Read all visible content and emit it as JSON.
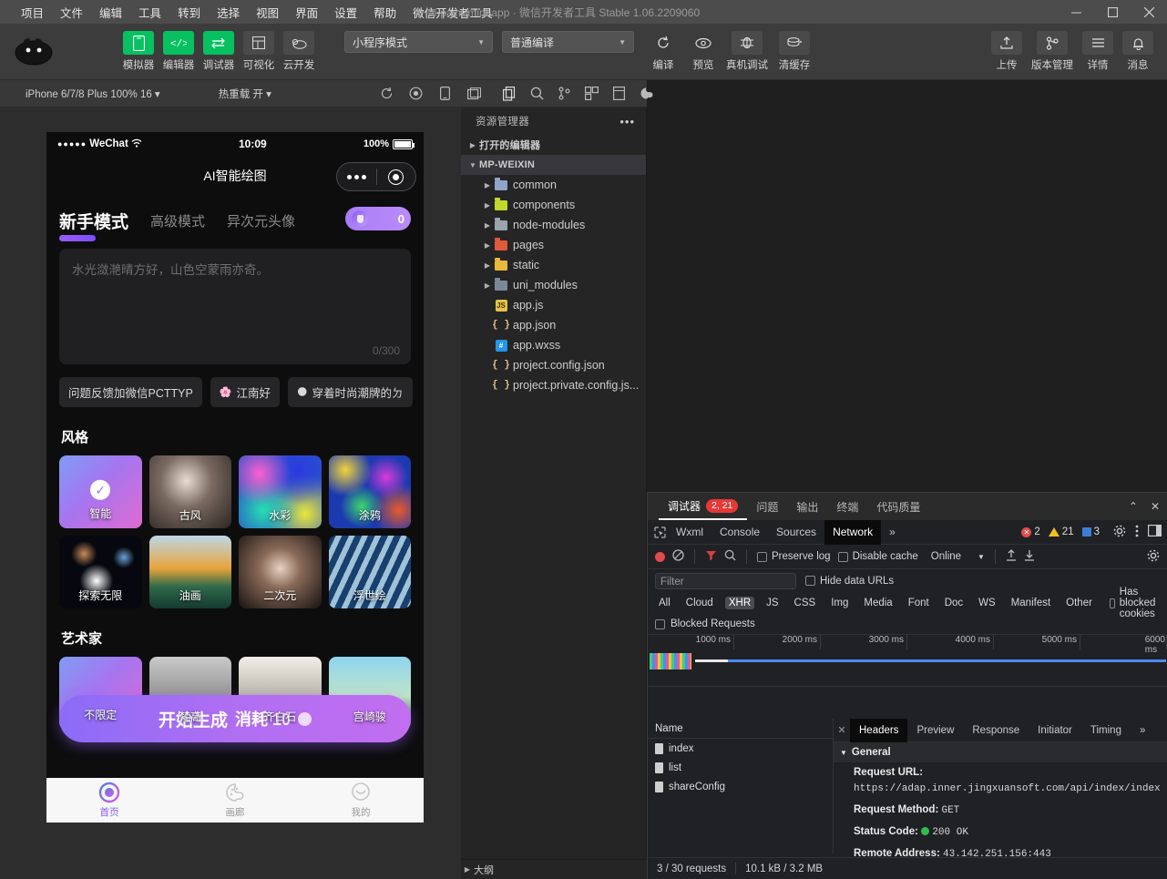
{
  "titlebar": {
    "menus": [
      "项目",
      "文件",
      "编辑",
      "工具",
      "转到",
      "选择",
      "视图",
      "界面",
      "设置",
      "帮助",
      "微信开发者工具"
    ],
    "title": "ai-paint-mini-app · 微信开发者工具 Stable 1.06.2209060",
    "minimize": "—",
    "maximize": "▢",
    "close": "✕"
  },
  "toolbar": {
    "left_buttons": [
      {
        "label": "模拟器",
        "icon": "phone-icon",
        "green": true
      },
      {
        "label": "编辑器",
        "icon": "code-icon",
        "green": true
      },
      {
        "label": "调试器",
        "icon": "debug-icon",
        "green": true
      },
      {
        "label": "可视化",
        "icon": "layout-icon",
        "green": false
      },
      {
        "label": "云开发",
        "icon": "cloud-icon",
        "green": false
      }
    ],
    "mode_select": "小程序模式",
    "compile_select": "普通编译",
    "mid_buttons": [
      {
        "label": "编译",
        "icon": "refresh-icon"
      },
      {
        "label": "预览",
        "icon": "eye-icon"
      },
      {
        "label": "真机调试",
        "icon": "device-debug-icon"
      },
      {
        "label": "清缓存",
        "icon": "clear-cache-icon"
      }
    ],
    "right_buttons": [
      {
        "label": "上传",
        "icon": "upload-icon"
      },
      {
        "label": "版本管理",
        "icon": "branch-icon"
      },
      {
        "label": "详情",
        "icon": "details-icon"
      },
      {
        "label": "消息",
        "icon": "bell-icon"
      }
    ]
  },
  "simbar": {
    "device": "iPhone 6/7/8 Plus 100% 16 ▾",
    "hot_reload": "热重载 开 ▾",
    "icons": [
      "rotate-icon",
      "record-icon",
      "mobile-icon",
      "screenshot-icon",
      "copy-icon",
      "search-icon",
      "git-icon",
      "component-icon",
      "panel-icon",
      "paint-icon"
    ]
  },
  "phone": {
    "status": {
      "carrier": "WeChat",
      "time": "10:09",
      "battery": "100%"
    },
    "nav_title": "AI智能绘图",
    "tabs": [
      {
        "label": "新手模式",
        "active": true
      },
      {
        "label": "高级模式",
        "active": false
      },
      {
        "label": "异次元头像",
        "active": false
      }
    ],
    "coins": "0",
    "prompt": {
      "placeholder": "水光潋滟晴方好，山色空蒙雨亦奇。",
      "counter": "0/300"
    },
    "chips": [
      {
        "label": "问题反馈加微信PCTTYP",
        "emoji": ""
      },
      {
        "label": "江南好",
        "emoji": "🌸"
      },
      {
        "label": "穿着时尚潮牌的ㄉ",
        "emoji": "🌑"
      }
    ],
    "style_section": "风格",
    "styles": [
      {
        "label": "智能",
        "selected": true
      },
      {
        "label": "古风",
        "selected": false
      },
      {
        "label": "水彩",
        "selected": false
      },
      {
        "label": "涂鸦",
        "selected": false
      },
      {
        "label": "探索无限",
        "selected": false
      },
      {
        "label": "油画",
        "selected": false
      },
      {
        "label": "二次元",
        "selected": false
      },
      {
        "label": "浮世绘",
        "selected": false
      }
    ],
    "artist_section": "艺术家",
    "artists": [
      {
        "label": "不限定",
        "selected": true
      },
      {
        "label": "梵高",
        "selected": false
      },
      {
        "label": "齐白石",
        "selected": false
      },
      {
        "label": "宫崎骏",
        "selected": false
      }
    ],
    "cta": {
      "label": "开始生成",
      "cost": "消耗 10"
    },
    "tabbar": [
      {
        "label": "首页",
        "active": true,
        "icon": "home-icon"
      },
      {
        "label": "画廊",
        "active": false,
        "icon": "gallery-icon"
      },
      {
        "label": "我的",
        "active": false,
        "icon": "profile-icon"
      }
    ]
  },
  "explorer": {
    "title": "资源管理器",
    "more": "•••",
    "open_editors": "打开的编辑器",
    "project": "MP-WEIXIN",
    "outline": "大纲",
    "files": [
      {
        "name": "common",
        "type": "folder",
        "color": "#8fa5c8",
        "depth": 2
      },
      {
        "name": "components",
        "type": "folder",
        "color": "#c2d82e",
        "depth": 2
      },
      {
        "name": "node-modules",
        "type": "folder",
        "color": "#9aa4ad",
        "depth": 2
      },
      {
        "name": "pages",
        "type": "folder",
        "color": "#e05a3a",
        "depth": 2
      },
      {
        "name": "static",
        "type": "folder",
        "color": "#e8b93a",
        "depth": 2
      },
      {
        "name": "uni_modules",
        "type": "folder",
        "color": "#7b8996",
        "depth": 2
      },
      {
        "name": "app.js",
        "type": "js",
        "depth": 2
      },
      {
        "name": "app.json",
        "type": "json",
        "depth": 2
      },
      {
        "name": "app.wxss",
        "type": "wxss",
        "depth": 2
      },
      {
        "name": "project.config.json",
        "type": "json",
        "depth": 2
      },
      {
        "name": "project.private.config.js...",
        "type": "json",
        "depth": 2
      }
    ]
  },
  "devtools": {
    "panel_tabs": [
      {
        "label": "调试器",
        "active": true,
        "badge": "2, 21"
      },
      {
        "label": "问题",
        "active": false
      },
      {
        "label": "输出",
        "active": false
      },
      {
        "label": "终端",
        "active": false
      },
      {
        "label": "代码质量",
        "active": false
      }
    ],
    "collapse": "⌃",
    "close": "✕",
    "subtabs": [
      {
        "label": "Wxml",
        "active": false
      },
      {
        "label": "Console",
        "active": false
      },
      {
        "label": "Sources",
        "active": false
      },
      {
        "label": "Network",
        "active": true
      },
      {
        "label": "»",
        "active": false
      }
    ],
    "counts": {
      "errors": "2",
      "warnings": "21",
      "infos": "3"
    },
    "network_controls": {
      "preserve_log": "Preserve log",
      "disable_cache": "Disable cache",
      "throttle": "Online",
      "filter_placeholder": "Filter",
      "hide_data_urls": "Hide data URLs",
      "blocked_requests": "Blocked Requests",
      "has_blocked_cookies": "Has blocked cookies",
      "types": [
        "All",
        "Cloud",
        "XHR",
        "JS",
        "CSS",
        "Img",
        "Media",
        "Font",
        "Doc",
        "WS",
        "Manifest",
        "Other"
      ],
      "selected_type": "XHR"
    },
    "overview_ticks": [
      "1000 ms",
      "2000 ms",
      "3000 ms",
      "4000 ms",
      "5000 ms",
      "6000 ms"
    ],
    "request_list": {
      "header": "Name",
      "rows": [
        "index",
        "list",
        "shareConfig"
      ]
    },
    "detail_tabs": [
      {
        "label": "Headers",
        "active": true
      },
      {
        "label": "Preview",
        "active": false
      },
      {
        "label": "Response",
        "active": false
      },
      {
        "label": "Initiator",
        "active": false
      },
      {
        "label": "Timing",
        "active": false
      },
      {
        "label": "»",
        "active": false
      }
    ],
    "general_section": "General",
    "headers": [
      {
        "key": "Request URL:",
        "value": "https://adap.inner.jingxuansoft.com/api/index/index"
      },
      {
        "key": "Request Method:",
        "value": "GET"
      },
      {
        "key": "Status Code:",
        "value": "200 OK",
        "status": true
      },
      {
        "key": "Remote Address:",
        "value": "43.142.251.156:443"
      }
    ],
    "status_bar": {
      "requests": "3 / 30 requests",
      "transfer": "10.1 kB / 3.2 MB"
    }
  }
}
